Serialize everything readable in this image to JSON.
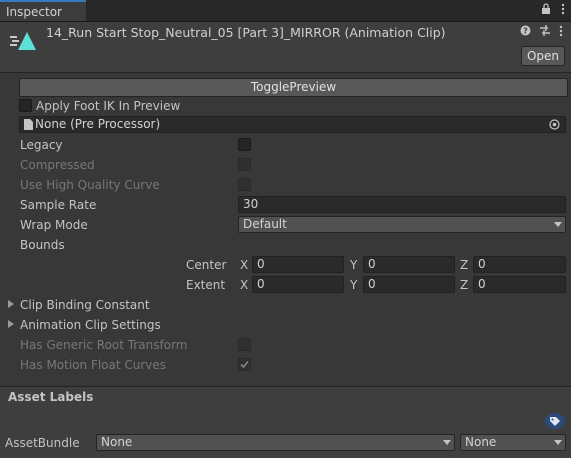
{
  "tab": {
    "label": "Inspector",
    "lock_icon": "lock-icon",
    "menu_icon": "more-vert-icon"
  },
  "header": {
    "title": "14_Run Start Stop_Neutral_05 [Part 3]_MIRROR (Animation Clip)",
    "icon": "animation-clip-icon",
    "help_icon": "help-icon",
    "settings_icon": "preset-icon",
    "menu_icon": "more-vert-icon",
    "open_button": "Open"
  },
  "toggle_preview": "TogglePreview",
  "apply_foot_ik": {
    "label": "Apply Foot IK In Preview",
    "checked": false
  },
  "preprocessor": {
    "value": "None (Pre Processor)",
    "icon": "object-picker-icon"
  },
  "fields": {
    "legacy": {
      "label": "Legacy",
      "checked": false
    },
    "compressed": {
      "label": "Compressed",
      "checked": false
    },
    "hq_curve": {
      "label": "Use High Quality Curve",
      "checked": false
    },
    "sample_rate": {
      "label": "Sample Rate",
      "value": "30"
    },
    "wrap_mode": {
      "label": "Wrap Mode",
      "value": "Default"
    },
    "bounds": {
      "label": "Bounds"
    },
    "center": {
      "label": "Center",
      "x_label": "X",
      "x": "0",
      "y_label": "Y",
      "y": "0",
      "z_label": "Z",
      "z": "0"
    },
    "extent": {
      "label": "Extent",
      "x_label": "X",
      "x": "0",
      "y_label": "Y",
      "y": "0",
      "z_label": "Z",
      "z": "0"
    },
    "clip_binding": {
      "label": "Clip Binding Constant"
    },
    "clip_settings": {
      "label": "Animation Clip Settings"
    },
    "generic_root": {
      "label": "Has Generic Root Transform",
      "checked": false
    },
    "motion_float": {
      "label": "Has Motion Float Curves",
      "checked": true
    }
  },
  "asset_labels": {
    "title": "Asset Labels",
    "tag_icon": "label-tag-icon"
  },
  "asset_bundle": {
    "label": "AssetBundle",
    "bundle": "None",
    "variant": "None"
  }
}
